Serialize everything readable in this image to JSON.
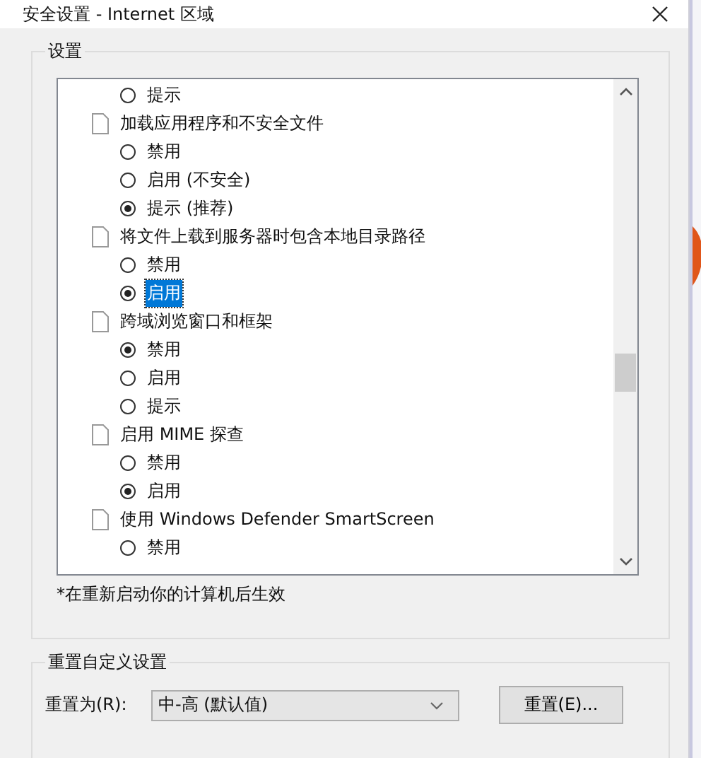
{
  "window": {
    "title": "安全设置 - Internet 区域"
  },
  "settings": {
    "title": "设置",
    "items": [
      {
        "kind": "radio",
        "label": "提示",
        "selected": false,
        "focused": false
      },
      {
        "kind": "setting",
        "label": "加载应用程序和不安全文件"
      },
      {
        "kind": "radio",
        "label": "禁用",
        "selected": false,
        "focused": false
      },
      {
        "kind": "radio",
        "label": "启用 (不安全)",
        "selected": false,
        "focused": false
      },
      {
        "kind": "radio",
        "label": "提示 (推荐)",
        "selected": true,
        "focused": false
      },
      {
        "kind": "setting",
        "label": "将文件上载到服务器时包含本地目录路径"
      },
      {
        "kind": "radio",
        "label": "禁用",
        "selected": false,
        "focused": false
      },
      {
        "kind": "radio",
        "label": "启用",
        "selected": true,
        "focused": true
      },
      {
        "kind": "setting",
        "label": "跨域浏览窗口和框架"
      },
      {
        "kind": "radio",
        "label": "禁用",
        "selected": true,
        "focused": false
      },
      {
        "kind": "radio",
        "label": "启用",
        "selected": false,
        "focused": false
      },
      {
        "kind": "radio",
        "label": "提示",
        "selected": false,
        "focused": false
      },
      {
        "kind": "setting",
        "label": "启用 MIME 探查"
      },
      {
        "kind": "radio",
        "label": "禁用",
        "selected": false,
        "focused": false
      },
      {
        "kind": "radio",
        "label": "启用",
        "selected": true,
        "focused": false
      },
      {
        "kind": "setting",
        "label": "使用 Windows Defender SmartScreen"
      },
      {
        "kind": "radio",
        "label": "禁用",
        "selected": false,
        "focused": false
      }
    ],
    "note": "*在重新启动你的计算机后生效"
  },
  "reset": {
    "title": "重置自定义设置",
    "label": "重置为(R):",
    "value": "中-高 (默认值)",
    "button": "重置(E)..."
  }
}
